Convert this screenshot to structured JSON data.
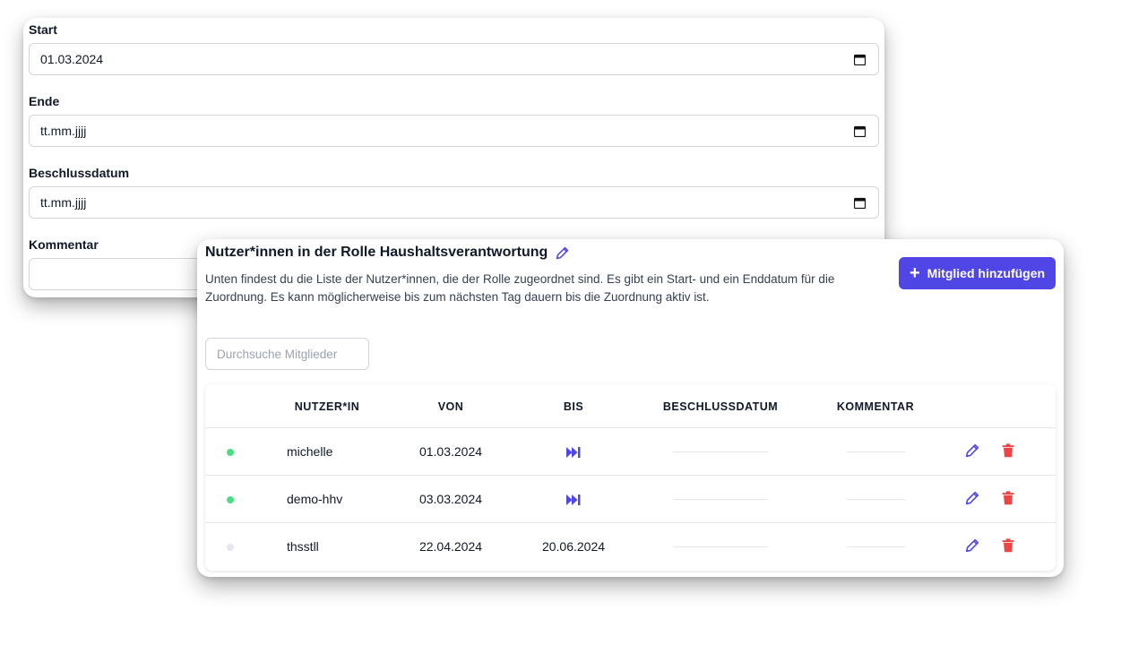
{
  "form": {
    "start_label": "Start",
    "start_value": "01.03.2024",
    "end_label": "Ende",
    "end_value": "tt.mm.jjjj",
    "decision_label": "Beschlussdatum",
    "decision_value": "tt.mm.jjjj",
    "comment_label": "Kommentar"
  },
  "members": {
    "title": "Nutzer*innen in der Rolle Haushaltsverantwortung",
    "description": "Unten findest du die Liste der Nutzer*innen, die der Rolle zugeordnet sind. Es gibt ein Start- und ein Enddatum für die Zuordnung. Es kann möglicherweise bis zum nächsten Tag dauern bis die Zuordnung aktiv ist.",
    "add_button": "Mitglied hinzufügen",
    "search_placeholder": "Durchsuche Mitglieder",
    "columns": [
      "NUTZER*IN",
      "VON",
      "BIS",
      "BESCHLUSSDATUM",
      "KOMMENTAR"
    ],
    "rows": [
      {
        "status": "active",
        "user": "michelle",
        "from": "01.03.2024",
        "to": "",
        "to_open_ended": true
      },
      {
        "status": "active",
        "user": "demo-hhv",
        "from": "03.03.2024",
        "to": "",
        "to_open_ended": true
      },
      {
        "status": "inactive",
        "user": "thsstll",
        "from": "22.04.2024",
        "to": "20.06.2024",
        "to_open_ended": false
      }
    ]
  },
  "colors": {
    "accent": "#4f46e5",
    "active": "#4ade80",
    "inactive": "#e5e7eb",
    "delete": "#ef4444"
  },
  "icons": {
    "edit": "pencil-icon",
    "delete": "trash-icon",
    "open_end": "fast-forward-icon",
    "calendar": "calendar-icon",
    "add": "plus-icon"
  }
}
